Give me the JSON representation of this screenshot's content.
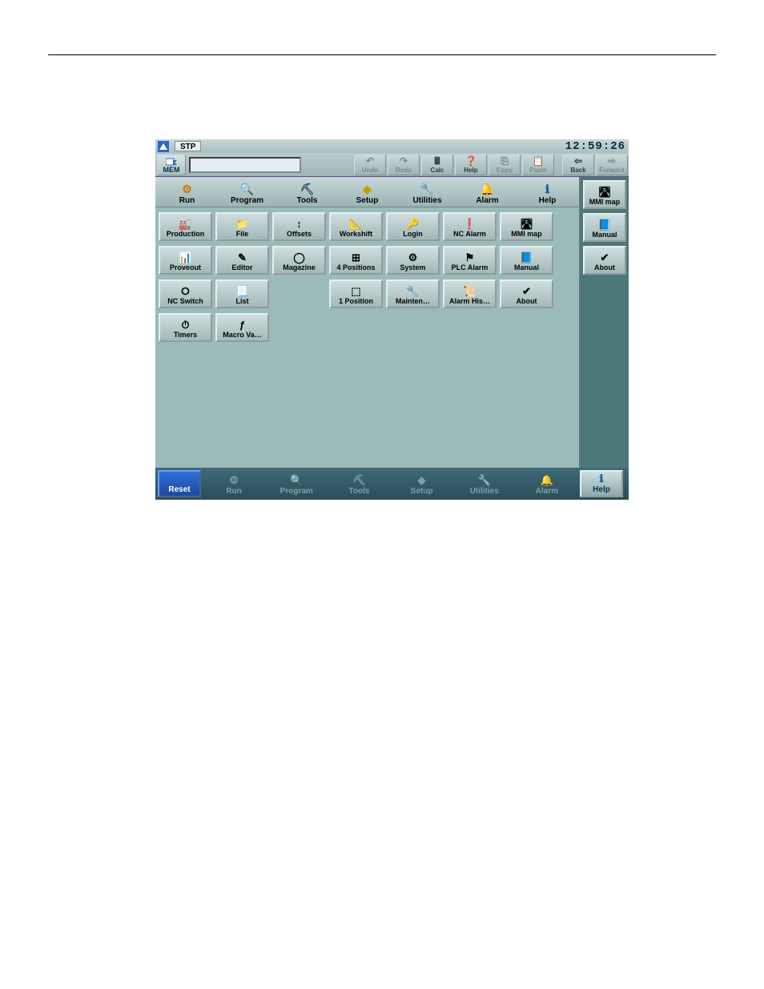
{
  "title": {
    "status": "STP",
    "clock": "12:59:26"
  },
  "top_toolbar": {
    "mem": "MEM",
    "buttons": [
      {
        "label": "Undo",
        "disabled": true,
        "icon": "↶"
      },
      {
        "label": "Redo",
        "disabled": true,
        "icon": "↷"
      },
      {
        "label": "Calc",
        "disabled": false,
        "icon": "🖩"
      },
      {
        "label": "Help",
        "disabled": false,
        "icon": "❓"
      },
      {
        "label": "Copy",
        "disabled": true,
        "icon": "⎘"
      },
      {
        "label": "Paste",
        "disabled": true,
        "icon": "📋"
      },
      {
        "label": "Back",
        "disabled": false,
        "icon": "⇦"
      },
      {
        "label": "Forward",
        "disabled": true,
        "icon": "⇨"
      }
    ]
  },
  "categories": [
    {
      "label": "Run",
      "icon": "⚙",
      "color": "#cc7a00"
    },
    {
      "label": "Program",
      "icon": "🔍",
      "color": "#555"
    },
    {
      "label": "Tools",
      "icon": "⛏",
      "color": "#2a4a6a"
    },
    {
      "label": "Setup",
      "icon": "◆",
      "color": "#cc9900"
    },
    {
      "label": "Utilities",
      "icon": "🔧",
      "color": "#777"
    },
    {
      "label": "Alarm",
      "icon": "🔔",
      "color": "#0b8a2f"
    },
    {
      "label": "Help",
      "icon": "ℹ",
      "color": "#0b5aa8"
    }
  ],
  "grid": [
    [
      {
        "label": "Production",
        "icon": "🏭"
      },
      {
        "label": "File",
        "icon": "📁"
      },
      {
        "label": "Offsets",
        "icon": "↕"
      },
      {
        "label": "Workshift",
        "icon": "📐"
      },
      {
        "label": "Login",
        "icon": "🔑"
      },
      {
        "label": "NC Alarm",
        "icon": "❗"
      },
      {
        "label": "MMI map",
        "icon": "🛣"
      }
    ],
    [
      {
        "label": "Proveout",
        "icon": "📊"
      },
      {
        "label": "Editor",
        "icon": "✎"
      },
      {
        "label": "Magazine",
        "icon": "◯"
      },
      {
        "label": "4 Positions",
        "icon": "⊞"
      },
      {
        "label": "System",
        "icon": "⚙"
      },
      {
        "label": "PLC Alarm",
        "icon": "⚑"
      },
      {
        "label": "Manual",
        "icon": "📘"
      }
    ],
    [
      {
        "label": "NC Switch",
        "icon": "⭘"
      },
      {
        "label": "List",
        "icon": "📃"
      },
      null,
      {
        "label": "1 Position",
        "icon": "⬚"
      },
      {
        "label": "Mainten…",
        "icon": "🔧"
      },
      {
        "label": "Alarm His…",
        "icon": "📜"
      },
      {
        "label": "About",
        "icon": "✔"
      }
    ],
    [
      {
        "label": "Timers",
        "icon": "⏱"
      },
      {
        "label": "Macro Va…",
        "icon": "ƒ"
      },
      null,
      null,
      null,
      null,
      null
    ]
  ],
  "side": [
    {
      "label": "MMI map",
      "icon": "🛣"
    },
    {
      "label": "Manual",
      "icon": "📘"
    },
    {
      "label": "About",
      "icon": "✔"
    }
  ],
  "bottom": {
    "reset": "Reset",
    "items": [
      {
        "label": "Run",
        "icon": "⚙"
      },
      {
        "label": "Program",
        "icon": "🔍"
      },
      {
        "label": "Tools",
        "icon": "⛏"
      },
      {
        "label": "Setup",
        "icon": "◆"
      },
      {
        "label": "Utilities",
        "icon": "🔧"
      },
      {
        "label": "Alarm",
        "icon": "🔔"
      }
    ],
    "help": "Help"
  }
}
